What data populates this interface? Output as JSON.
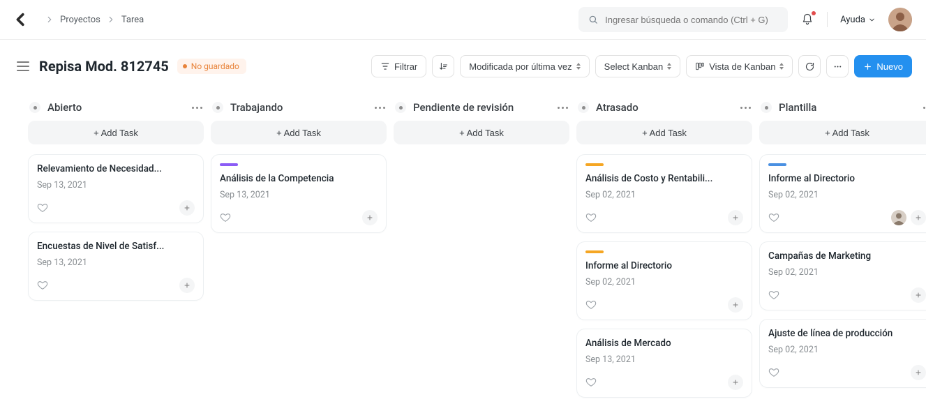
{
  "breadcrumb": {
    "projects": "Proyectos",
    "task": "Tarea"
  },
  "search": {
    "placeholder": "Ingresar búsqueda o comando (Ctrl + G)"
  },
  "help": {
    "label": "Ayuda"
  },
  "page": {
    "title": "Repisa Mod. 812745",
    "unsaved": "No guardado"
  },
  "toolbar": {
    "filter": "Filtrar",
    "sort": "Modificada por última vez",
    "select_kanban": "Select Kanban",
    "view": "Vista de Kanban",
    "new": "Nuevo"
  },
  "add_task_label": "+ Add Task",
  "columns": [
    {
      "title": "Abierto",
      "cards": [
        {
          "tag": null,
          "title": "Relevamiento de Necesidad...",
          "date": "Sep 13, 2021",
          "assignee": false
        },
        {
          "tag": null,
          "title": "Encuestas de Nivel de Satisf...",
          "date": "Sep 13, 2021",
          "assignee": false
        }
      ]
    },
    {
      "title": "Trabajando",
      "cards": [
        {
          "tag": "purple",
          "title": "Análisis de la Competencia",
          "date": "Sep 13, 2021",
          "assignee": false
        }
      ]
    },
    {
      "title": "Pendiente de revisión",
      "cards": []
    },
    {
      "title": "Atrasado",
      "cards": [
        {
          "tag": "amber",
          "title": "Análisis de Costo y Rentabili...",
          "date": "Sep 02, 2021",
          "assignee": false
        },
        {
          "tag": "amber",
          "title": "Informe al Directorio",
          "date": "Sep 02, 2021",
          "assignee": false
        },
        {
          "tag": null,
          "title": "Análisis de Mercado",
          "date": "Sep 13, 2021",
          "assignee": false
        }
      ]
    },
    {
      "title": "Plantilla",
      "cards": [
        {
          "tag": "blue",
          "title": "Informe al Directorio",
          "date": "Sep 02, 2021",
          "assignee": true
        },
        {
          "tag": null,
          "title": "Campañas de Marketing",
          "date": "Sep 02, 2021",
          "assignee": false
        },
        {
          "tag": null,
          "title": "Ajuste de línea de producción",
          "date": "Sep 02, 2021",
          "assignee": false
        }
      ]
    }
  ]
}
